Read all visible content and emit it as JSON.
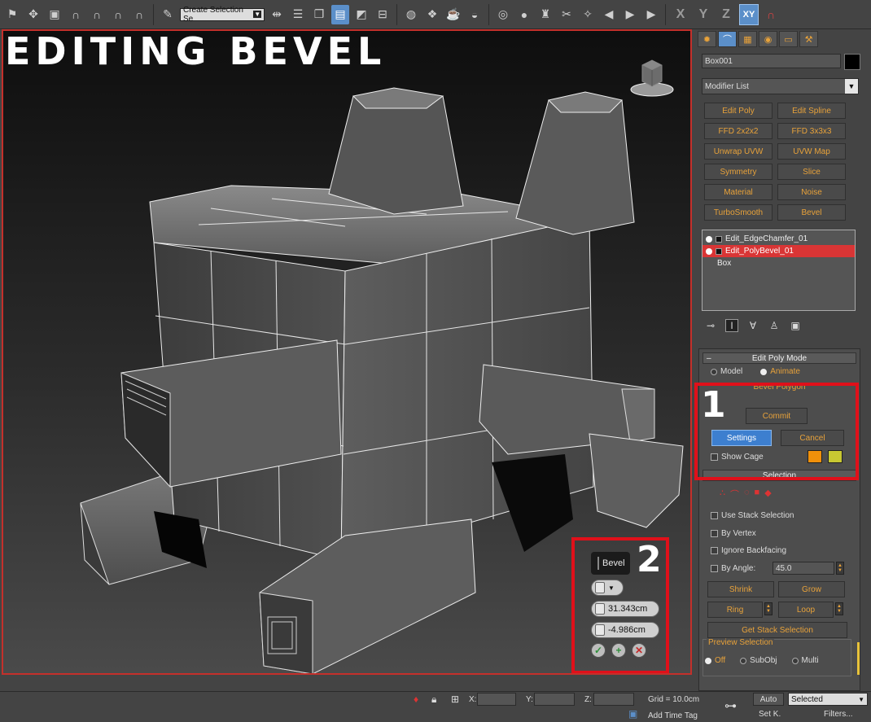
{
  "overlay": {
    "title": "EDITING BEVEL",
    "callout1": "1",
    "callout2": "2"
  },
  "toolbar": {
    "selection_set": "Create Selection Se",
    "axes": [
      "X",
      "Y",
      "Z",
      "XY"
    ]
  },
  "panel": {
    "object_name": "Box001",
    "modifier_list": "Modifier List",
    "modifier_buttons": [
      "Edit Poly",
      "Edit Spline",
      "FFD 2x2x2",
      "FFD 3x3x3",
      "Unwrap UVW",
      "UVW Map",
      "Symmetry",
      "Slice",
      "Material",
      "Noise",
      "TurboSmooth",
      "Bevel"
    ],
    "stack": [
      "Edit_EdgeChamfer_01",
      "Edit_PolyBevel_01",
      "Box"
    ],
    "edit_poly_mode": {
      "title": "Edit Poly Mode",
      "model": "Model",
      "animate": "Animate",
      "operation": "Bevel Polygon",
      "commit": "Commit",
      "settings": "Settings",
      "cancel": "Cancel",
      "show_cage": "Show Cage",
      "cage_colors": [
        "#f0900a",
        "#c8c832"
      ]
    },
    "selection": {
      "title": "Selection",
      "use_stack": "Use Stack Selection",
      "by_vertex": "By Vertex",
      "ignore_backfacing": "Ignore Backfacing",
      "by_angle": "By Angle:",
      "angle_value": "45.0",
      "shrink": "Shrink",
      "grow": "Grow",
      "ring": "Ring",
      "loop": "Loop",
      "get_stack": "Get Stack Selection",
      "preview": "Preview Selection",
      "off": "Off",
      "subobj": "SubObj",
      "multi": "Multi"
    }
  },
  "caddy": {
    "title": "Bevel",
    "height": "31.343cm",
    "outline": "-4.986cm"
  },
  "status": {
    "x": "X:",
    "y": "Y:",
    "z": "Z:",
    "grid": "Grid = 10.0cm",
    "auto": "Auto",
    "set_key": "Set K.",
    "key_filter": "Selected",
    "filters": "Filters...",
    "add_time_tag": "Add Time Tag"
  },
  "icons": [
    "key-icon",
    "lock-icon",
    "pin-icon",
    "check-icon",
    "plus-icon",
    "close-icon"
  ]
}
